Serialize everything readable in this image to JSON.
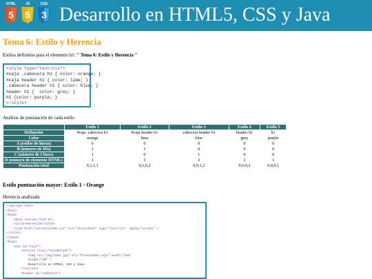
{
  "header": {
    "title": "Desarrollo en HTML5, CSS y Java",
    "logos": [
      {
        "label": "HTML",
        "glyph": "5",
        "color": "#e44d26"
      },
      {
        "label": "JS",
        "glyph": "5",
        "color": "#f0c419"
      },
      {
        "label": "CSS",
        "glyph": "3",
        "color": "#2965f1"
      }
    ]
  },
  "section": {
    "title": "Tema 6: Estilo y Herencia",
    "intro_prefix": "Estilos definidos para el elemento h1: ",
    "intro_bold": "\" Tema 6: Estilo y Herencia \""
  },
  "code_block_1": [
    "<style type=\"text/css\">",
    "#caja .cabecera h1 { color: orange; }",
    "#caja header h1 { color: lime; }",
    ".cabecera header h1 { color: blue; }",
    "header h1 {  color: grey; }",
    "h1 {color: purple; }",
    "</style>"
  ],
  "analysis_label": "Análisis de puntuación de cada estilo",
  "table": {
    "columns": [
      "",
      "Estilo 1",
      "Estilo 2",
      "Estilo 3",
      "Estilo 4",
      "Estilo 5"
    ],
    "rows": [
      {
        "header": "Definición",
        "cells": [
          "#caja .cabecera h1",
          "#caja header h1",
          ".cabecera header h1",
          "header h1",
          "h1"
        ]
      },
      {
        "header": "Color",
        "cells": [
          "orange",
          "lime",
          "blue",
          "grey",
          "purple"
        ]
      },
      {
        "header": "A (estilos de líneas)",
        "cells": [
          "0",
          "0",
          "0",
          "0",
          "0"
        ]
      },
      {
        "header": "B (número de IDs)",
        "cells": [
          "1",
          "1",
          "0",
          "0",
          "0"
        ]
      },
      {
        "header": "C (número de Clases)",
        "cells": [
          "1",
          "0",
          "1",
          "0",
          "0"
        ]
      },
      {
        "header": "D (número de elemento HTML)",
        "cells": [
          "1",
          "1",
          "2",
          "2",
          "1"
        ]
      },
      {
        "header": "Puntuación total",
        "cells": [
          "0,1,1,1",
          "0,1,0,2",
          "0,0,1,2",
          "0,0,0,2",
          "0,0,0,1"
        ]
      }
    ]
  },
  "winner": "Estilo puntuación mayor: Estilo 1 - Orange",
  "herencia_label": "Herencia analizada",
  "code_block_2": [
    {
      "text": "<!doctype html>",
      "kind": "tag"
    },
    {
      "text": "<html>",
      "kind": "tag"
    },
    {
      "text": "<head>",
      "kind": "tag"
    },
    {
      "text": "    <meta charset=\"utf-8\">",
      "kind": "tag"
    },
    {
      "text": "    <title>Herencia</title>",
      "kind": "tag"
    },
    {
      "text": "    <link href=\"css/estilo06.css\" rel=\"stylesheet\" type=\"text/css\"  media=\"screen\" >",
      "kind": "tag"
    },
    {
      "text": "</style>",
      "kind": "tag"
    },
    {
      "text": "</head>",
      "kind": "tag"
    },
    {
      "text": "<body>",
      "kind": "tag"
    },
    {
      "text": "    <div id=\"caja\">",
      "kind": "tag"
    },
    {
      "text": "        <section class=\"encabezado\">",
      "kind": "tag"
    },
    {
      "text": "            <img src=\"img/tema.jpg\" alt=\"FreeCodeDG Logo\" width=\"150\"",
      "kind": "tag"
    },
    {
      "text": "            height=\"50\" >",
      "kind": "tag"
    },
    {
      "text": "            Desarrollo en HTML5, CSS y Java",
      "kind": "text"
    },
    {
      "text": "        </section>",
      "kind": "tag"
    },
    {
      "text": "        <header id=\"cabecera\">",
      "kind": "tag"
    }
  ]
}
